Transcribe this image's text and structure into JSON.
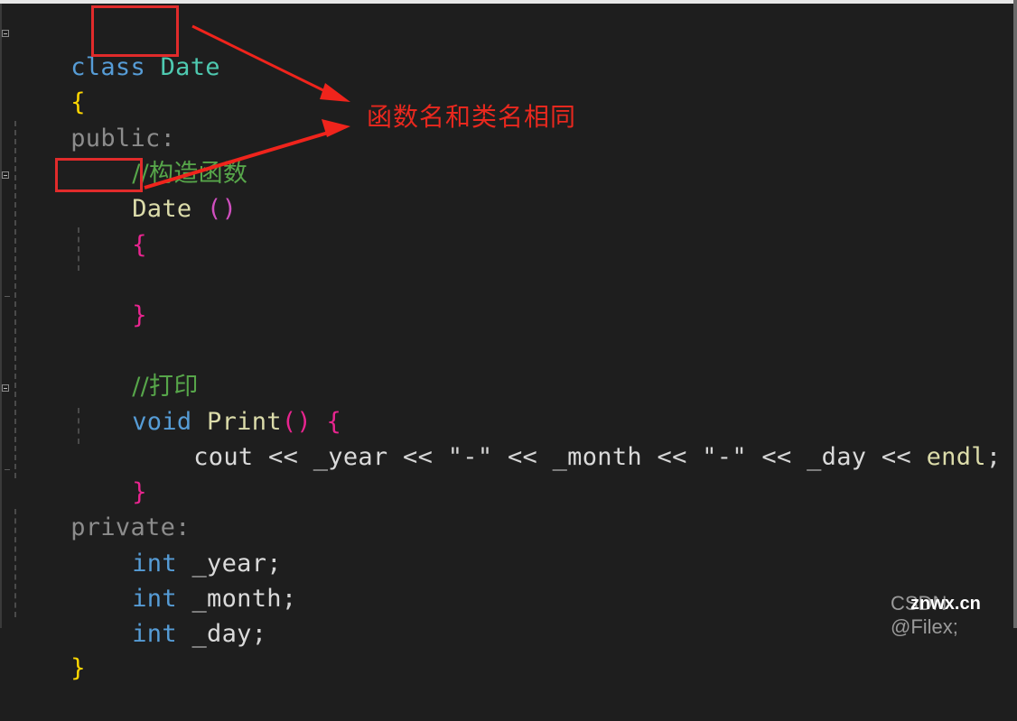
{
  "code": {
    "line1": {
      "keyword": "class",
      "space": " ",
      "name": "Date"
    },
    "line2": {
      "brace": "{"
    },
    "line3": {
      "access": "public:"
    },
    "line4": {
      "comment": "//构造函数"
    },
    "line5": {
      "name": "Date",
      "space": " ",
      "parens": "()"
    },
    "line6": {
      "brace": "{"
    },
    "line8": {
      "brace": "}"
    },
    "line10": {
      "comment": "//打印"
    },
    "line11": {
      "keyword": "void",
      "space": " ",
      "name": "Print",
      "parens": "()",
      "space2": " ",
      "brace": "{"
    },
    "line12": {
      "cout": "cout",
      "op1": " << ",
      "v1": "_year",
      "op2": " << ",
      "s1": "\"-\"",
      "op3": " << ",
      "v2": "_month",
      "op4": " << ",
      "s2": "\"-\"",
      "op5": " << ",
      "v3": "_day",
      "op6": " << ",
      "endl": "endl",
      "semi": ";"
    },
    "line13": {
      "brace": "}"
    },
    "line14": {
      "access": "private:"
    },
    "line15": {
      "type": "int",
      "space": " ",
      "name": "_year",
      "semi": ";"
    },
    "line16": {
      "type": "int",
      "space": " ",
      "name": "_month",
      "semi": ";"
    },
    "line17": {
      "type": "int",
      "space": " ",
      "name": "_day",
      "semi": ";"
    },
    "line18": {
      "brace": "}"
    }
  },
  "annotation": {
    "text": "函数名和类名相同",
    "color": "#e8281e"
  },
  "colors": {
    "background": "#1e1e1e",
    "keyword": "#569cd6",
    "class_name": "#4ec9b0",
    "function": "#dcdcaa",
    "comment": "#57a64a",
    "highlight_box": "#e12b2b"
  },
  "watermark": {
    "text": "CSDN @Filex;",
    "overlay": "znwx.cn"
  }
}
